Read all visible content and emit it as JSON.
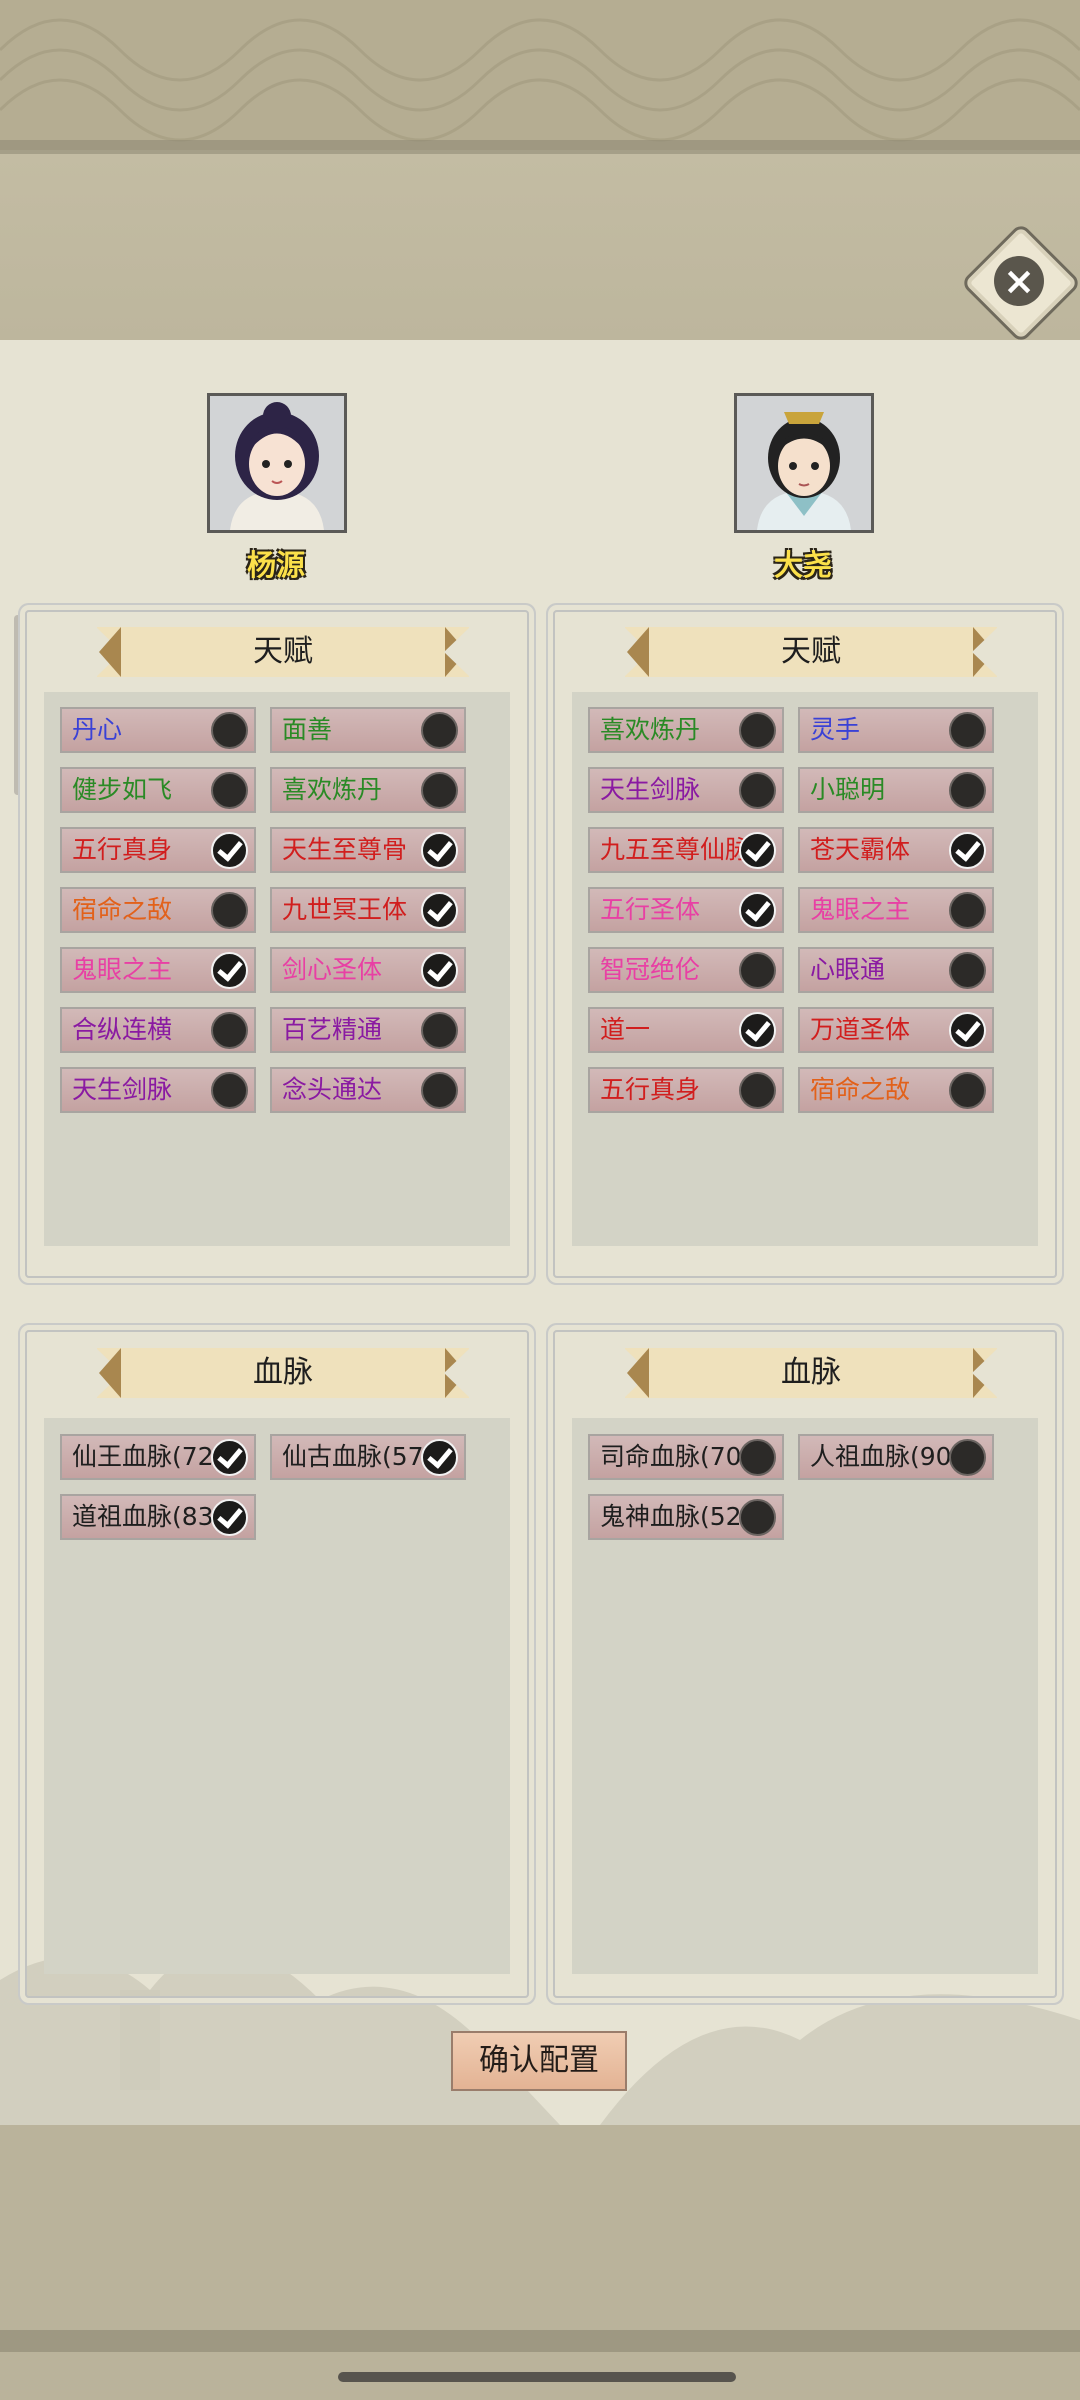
{
  "characters": [
    {
      "name": "杨源"
    },
    {
      "name": "大尧"
    }
  ],
  "sections": {
    "talent_title": "天赋",
    "bloodline_title": "血脉"
  },
  "colors": {
    "blue": "#3a41d6",
    "green": "#2a8a25",
    "red": "#d11e1e",
    "orange": "#e2611a",
    "pink": "#e840a4",
    "purple": "#8a1aa2",
    "black": "#1e1e1e"
  },
  "left_talents": [
    {
      "label": "丹心",
      "checked": false,
      "color": "blue"
    },
    {
      "label": "面善",
      "checked": false,
      "color": "green"
    },
    {
      "label": "健步如飞",
      "checked": false,
      "color": "green"
    },
    {
      "label": "喜欢炼丹",
      "checked": false,
      "color": "green"
    },
    {
      "label": "五行真身",
      "checked": true,
      "color": "red"
    },
    {
      "label": "天生至尊骨",
      "checked": true,
      "color": "red"
    },
    {
      "label": "宿命之敌",
      "checked": false,
      "color": "orange"
    },
    {
      "label": "九世冥王体",
      "checked": true,
      "color": "red"
    },
    {
      "label": "鬼眼之主",
      "checked": true,
      "color": "pink"
    },
    {
      "label": "剑心圣体",
      "checked": true,
      "color": "pink"
    },
    {
      "label": "合纵连横",
      "checked": false,
      "color": "purple"
    },
    {
      "label": "百艺精通",
      "checked": false,
      "color": "purple"
    },
    {
      "label": "天生剑脉",
      "checked": false,
      "color": "purple"
    },
    {
      "label": "念头通达",
      "checked": false,
      "color": "purple"
    }
  ],
  "right_talents": [
    {
      "label": "喜欢炼丹",
      "checked": false,
      "color": "green"
    },
    {
      "label": "灵手",
      "checked": false,
      "color": "blue"
    },
    {
      "label": "天生剑脉",
      "checked": false,
      "color": "purple"
    },
    {
      "label": "小聪明",
      "checked": false,
      "color": "green"
    },
    {
      "label": "九五至尊仙脉",
      "checked": true,
      "color": "red"
    },
    {
      "label": "苍天霸体",
      "checked": true,
      "color": "red"
    },
    {
      "label": "五行圣体",
      "checked": true,
      "color": "pink"
    },
    {
      "label": "鬼眼之主",
      "checked": false,
      "color": "pink"
    },
    {
      "label": "智冠绝伦",
      "checked": false,
      "color": "pink"
    },
    {
      "label": "心眼通",
      "checked": false,
      "color": "purple"
    },
    {
      "label": "道一",
      "checked": true,
      "color": "red"
    },
    {
      "label": "万道圣体",
      "checked": true,
      "color": "red"
    },
    {
      "label": "五行真身",
      "checked": false,
      "color": "red"
    },
    {
      "label": "宿命之敌",
      "checked": false,
      "color": "orange"
    }
  ],
  "left_bloodlines": [
    {
      "label": "仙王血脉(72)",
      "checked": true
    },
    {
      "label": "仙古血脉(57)",
      "checked": true
    },
    {
      "label": "道祖血脉(83)",
      "checked": true
    }
  ],
  "right_bloodlines": [
    {
      "label": "司命血脉(70)",
      "checked": false
    },
    {
      "label": "人祖血脉(90)",
      "checked": false
    },
    {
      "label": "鬼神血脉(52)",
      "checked": false
    }
  ],
  "confirm_label": "确认配置"
}
